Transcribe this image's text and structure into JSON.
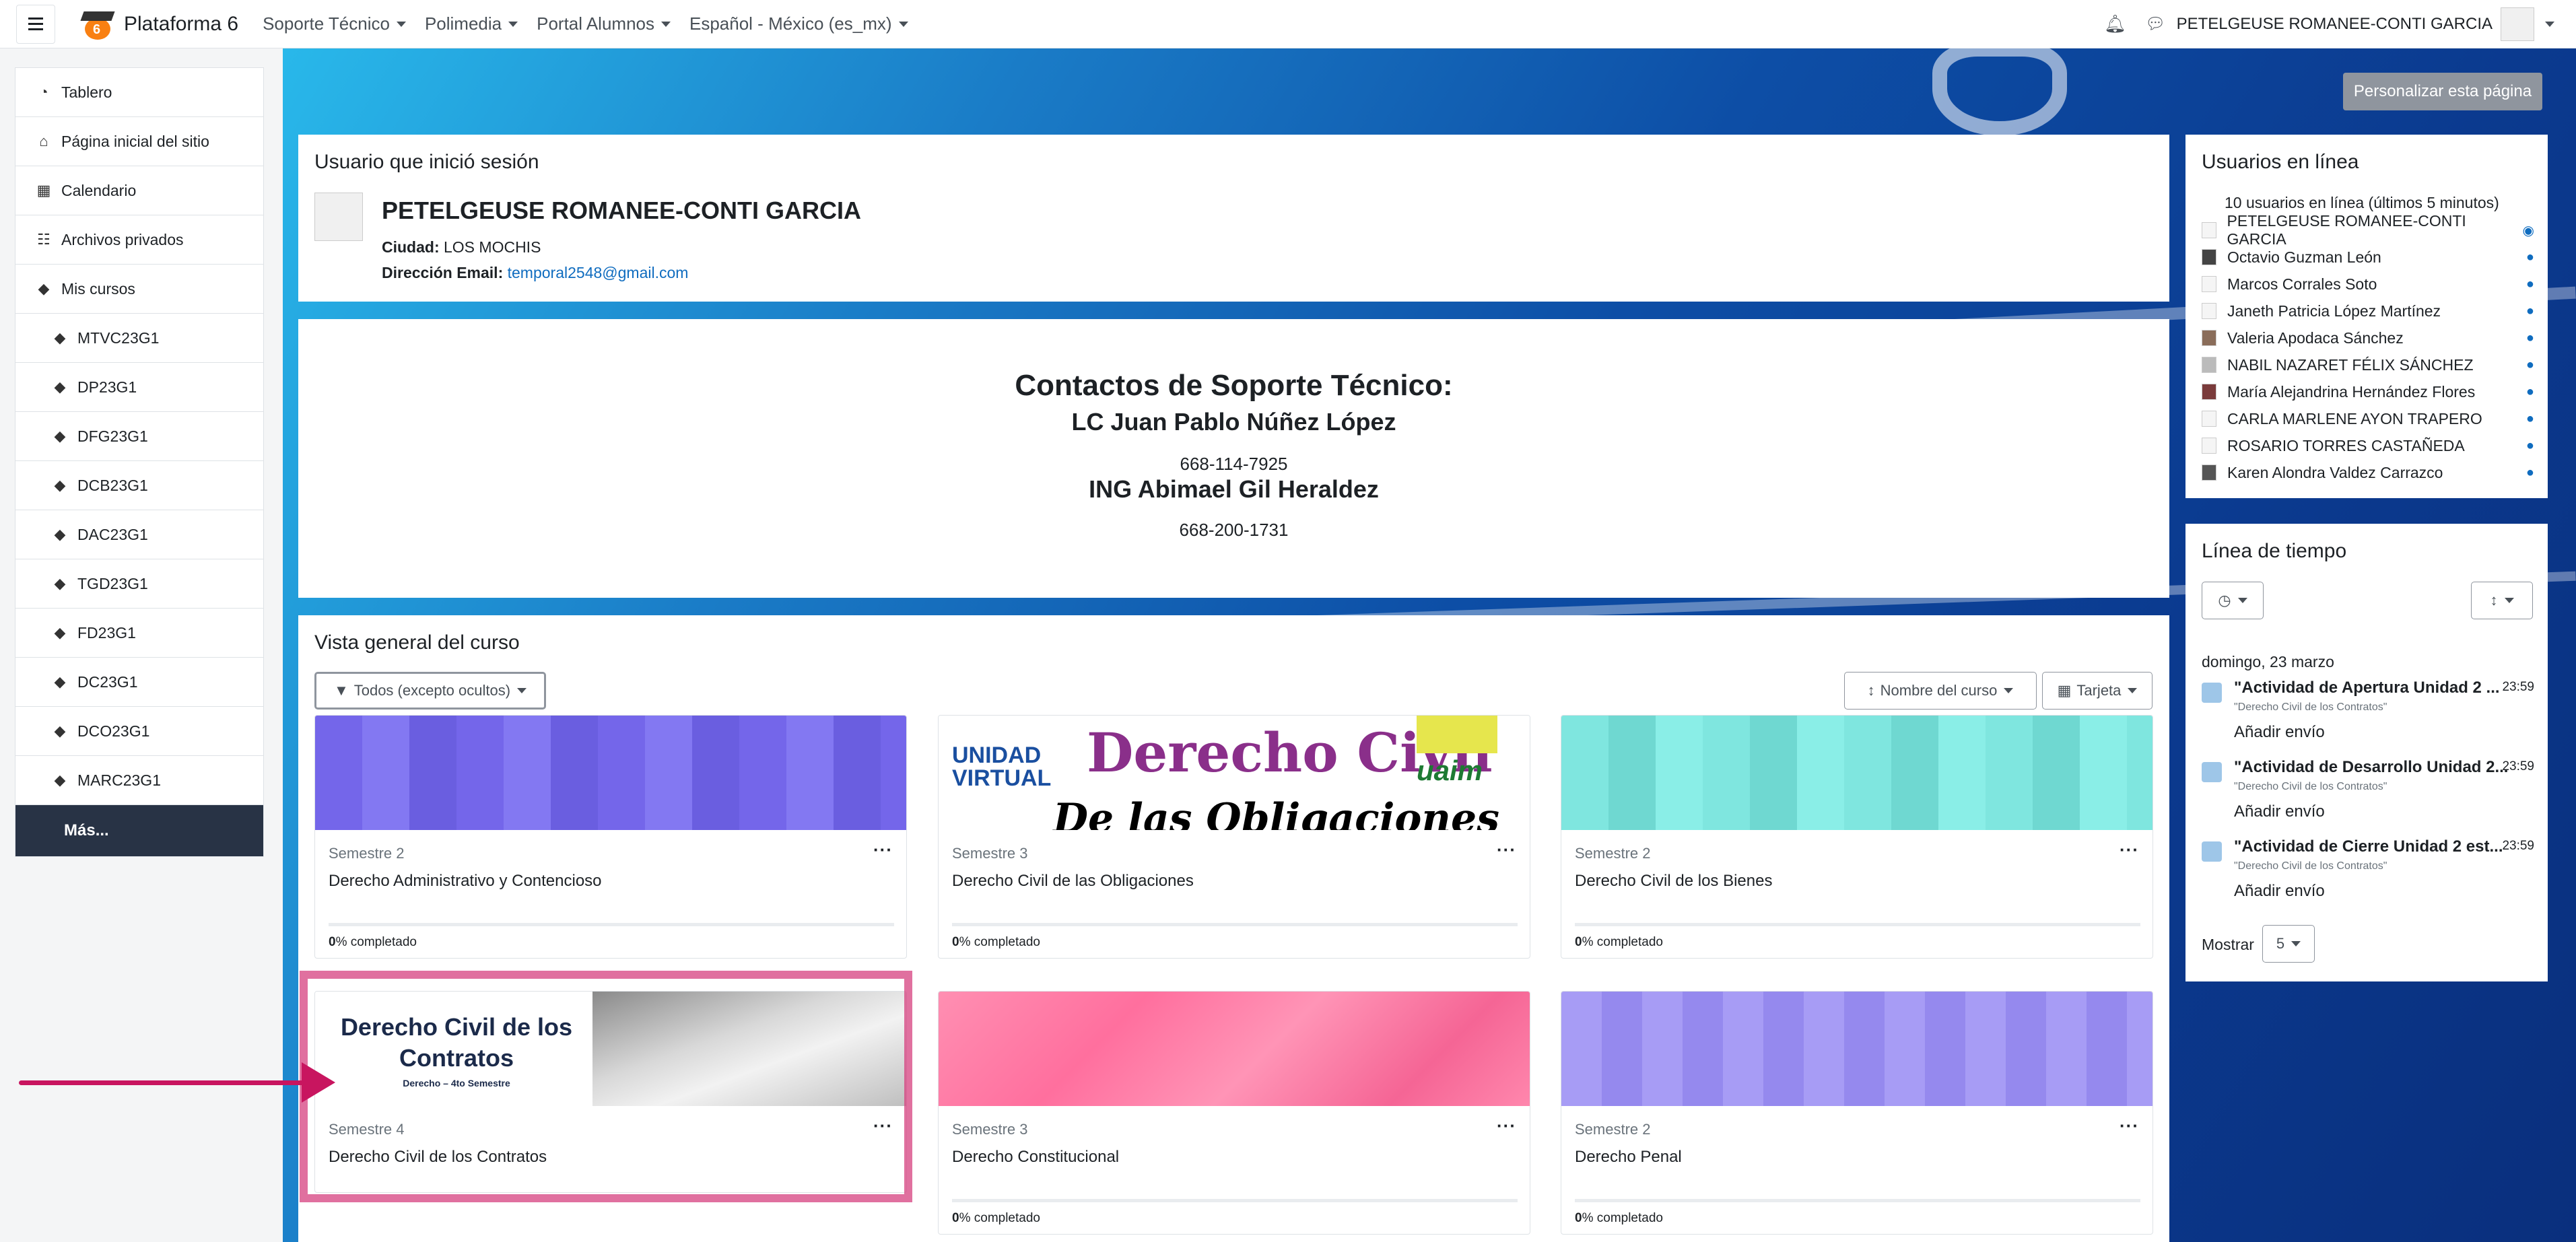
{
  "navbar": {
    "site_name": "Plataforma 6",
    "menu": [
      "Soporte Técnico",
      "Polimedia",
      "Portal Alumnos",
      "Español - México (es_mx)"
    ],
    "user_name": "PETELGEUSE ROMANEE-CONTI GARCIA"
  },
  "drawer": {
    "items": [
      {
        "label": "Tablero",
        "icon": "tachometer-icon"
      },
      {
        "label": "Página inicial del sitio",
        "icon": "home-icon"
      },
      {
        "label": "Calendario",
        "icon": "calendar-icon"
      },
      {
        "label": "Archivos privados",
        "icon": "file-icon"
      },
      {
        "label": "Mis cursos",
        "icon": "graduation-cap-icon"
      }
    ],
    "courses": [
      "MTVC23G1",
      "DP23G1",
      "DFG23G1",
      "DCB23G1",
      "DAC23G1",
      "TGD23G1",
      "FD23G1",
      "DC23G1",
      "DCO23G1",
      "MARC23G1"
    ],
    "more": "Más..."
  },
  "customize_button": "Personalizar esta página",
  "logged_user": {
    "title": "Usuario que inició sesión",
    "name": "PETELGEUSE ROMANEE-CONTI GARCIA",
    "city_label": "Ciudad:",
    "city": "LOS MOCHIS",
    "email_label": "Dirección Email:",
    "email": "temporal2548@gmail.com"
  },
  "support": {
    "title": "Contactos de Soporte Técnico:",
    "contact1_name": "LC Juan Pablo Núñez López",
    "contact1_phone": "668-114-7925",
    "contact2_name": "ING Abimael Gil Heraldez",
    "contact2_phone": "668-200-1731"
  },
  "overview": {
    "title": "Vista general del curso",
    "filter": "Todos (excepto ocultos)",
    "sort": "Nombre del curso",
    "view": "Tarjeta",
    "progress_suffix": "% completado",
    "courses": [
      {
        "semester": "Semestre 2",
        "name": "Derecho Administrativo y Contencioso",
        "progress": "0",
        "color": "#7b6ff0"
      },
      {
        "semester": "Semestre 3",
        "name": "Derecho Civil de las Obligaciones",
        "progress": "0",
        "color": "#ffffff"
      },
      {
        "semester": "Semestre 2",
        "name": "Derecho Civil de los Bienes",
        "progress": "0",
        "color": "#7fe6df"
      },
      {
        "semester": "Semestre 4",
        "name": "Derecho Civil de los Contratos",
        "progress": "",
        "color": "#ffffff"
      },
      {
        "semester": "Semestre 3",
        "name": "Derecho Constitucional",
        "progress": "0",
        "color": "#ff7fa8"
      },
      {
        "semester": "Semestre 2",
        "name": "Derecho Penal",
        "progress": "0",
        "color": "#a79cf5"
      }
    ],
    "banner_obligaciones": {
      "unidad": "UNIDAD",
      "virtual": "VIRTUAL",
      "title": "Derecho Civil",
      "sub": "De las Obligaciones",
      "uaim": "uaim"
    },
    "banner_contratos": {
      "line1": "Derecho Civil de los",
      "line2": "Contratos",
      "sub": "Derecho – 4to Semestre"
    }
  },
  "online_users": {
    "title": "Usuarios en línea",
    "summary": "10 usuarios en línea (últimos 5 minutos)",
    "users": [
      "PETELGEUSE ROMANEE-CONTI GARCIA",
      "Octavio Guzman León",
      "Marcos Corrales Soto",
      "Janeth Patricia López Martínez",
      "Valeria Apodaca Sánchez",
      "NABIL NAZARET FÉLIX SÁNCHEZ",
      "María Alejandrina Hernández Flores",
      "CARLA MARLENE AYON TRAPERO",
      "ROSARIO TORRES CASTAÑEDA",
      "Karen Alondra Valdez Carrazco"
    ]
  },
  "timeline": {
    "title": "Línea de tiempo",
    "date": "domingo, 23 marzo",
    "events": [
      {
        "name": "\"Actividad de Apertura Unidad 2 ...",
        "time": "23:59",
        "course": "\"Derecho Civil de los Contratos\"",
        "action": "Añadir envío"
      },
      {
        "name": "\"Actividad de Desarrollo Unidad 2...",
        "time": "23:59",
        "course": "\"Derecho Civil de los Contratos\"",
        "action": "Añadir envío"
      },
      {
        "name": "\"Actividad de Cierre Unidad 2 est...",
        "time": "23:59",
        "course": "\"Derecho Civil de los Contratos\"",
        "action": "Añadir envío"
      }
    ],
    "show_label": "Mostrar",
    "show_value": "5"
  },
  "colors": {
    "accent": "#0f6cbf",
    "highlight": "#d6407f",
    "drawer_more": "#283345"
  }
}
